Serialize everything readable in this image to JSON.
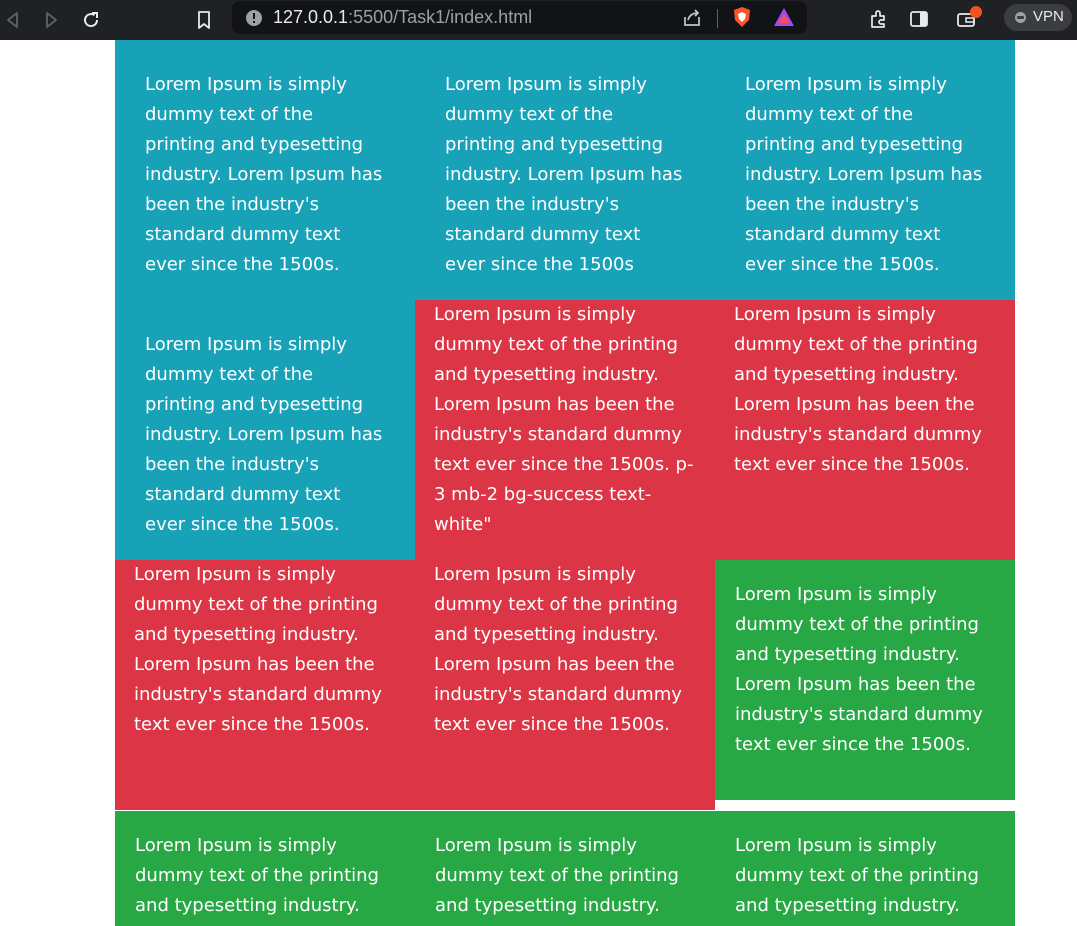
{
  "browser": {
    "url_host": "127.0.0.1",
    "url_path": ":5500/Task1/index.html",
    "vpn_label": "VPN"
  },
  "colors": {
    "info": "#17a2b8",
    "danger": "#dc3545",
    "success": "#28a745"
  },
  "cells": [
    {
      "text": "Lorem Ipsum is simply dummy text of the printing and typesetting industry. Lorem Ipsum has been the industry's standard dummy text ever since the 1500s."
    },
    {
      "text": "Lorem Ipsum is simply dummy text of the printing and typesetting industry. Lorem Ipsum has been the industry's standard dummy text ever since the 1500s"
    },
    {
      "text": "Lorem Ipsum is simply dummy text of the printing and typesetting industry. Lorem Ipsum has been the industry's standard dummy text ever since the 1500s."
    },
    {
      "text": "Lorem Ipsum is simply dummy text of the printing and typesetting industry. Lorem Ipsum has been the industry's standard dummy text ever since the 1500s."
    },
    {
      "text": "Lorem Ipsum is simply dummy text of the printing and typesetting industry. Lorem Ipsum has been the industry's standard dummy text ever since the 1500s. p-3 mb-2 bg-success text-white\""
    },
    {
      "text": "Lorem Ipsum is simply dummy text of the printing and typesetting industry. Lorem Ipsum has been the industry's standard dummy text ever since the 1500s."
    },
    {
      "text": "Lorem Ipsum is simply dummy text of the printing and typesetting industry. Lorem Ipsum has been the industry's standard dummy text ever since the 1500s."
    },
    {
      "text": "Lorem Ipsum is simply dummy text of the printing and typesetting industry. Lorem Ipsum has been the industry's standard dummy text ever since the 1500s."
    },
    {
      "text": "Lorem Ipsum is simply dummy text of the printing and typesetting industry. Lorem Ipsum has been the industry's standard dummy text ever since the 1500s."
    },
    {
      "text": "Lorem Ipsum is simply dummy text of the printing and typesetting industry."
    },
    {
      "text": "Lorem Ipsum is simply dummy text of the printing and typesetting industry."
    },
    {
      "text": "Lorem Ipsum is simply dummy text of the printing and typesetting industry."
    }
  ]
}
